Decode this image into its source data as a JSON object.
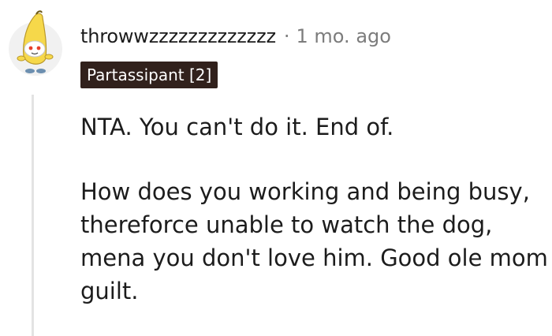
{
  "comment": {
    "username": "throwwzzzzzzzzzzzzz",
    "separator": "·",
    "timestamp": "1 mo. ago",
    "flair": "Partassipant [2]",
    "avatar_icon": "snoo-banana-avatar-icon",
    "paragraphs": [
      "NTA. You can't do it. End of.",
      "How does you working and being busy, thereforce unable to watch the dog, mena you don't love him. Good ole mom guilt."
    ]
  }
}
